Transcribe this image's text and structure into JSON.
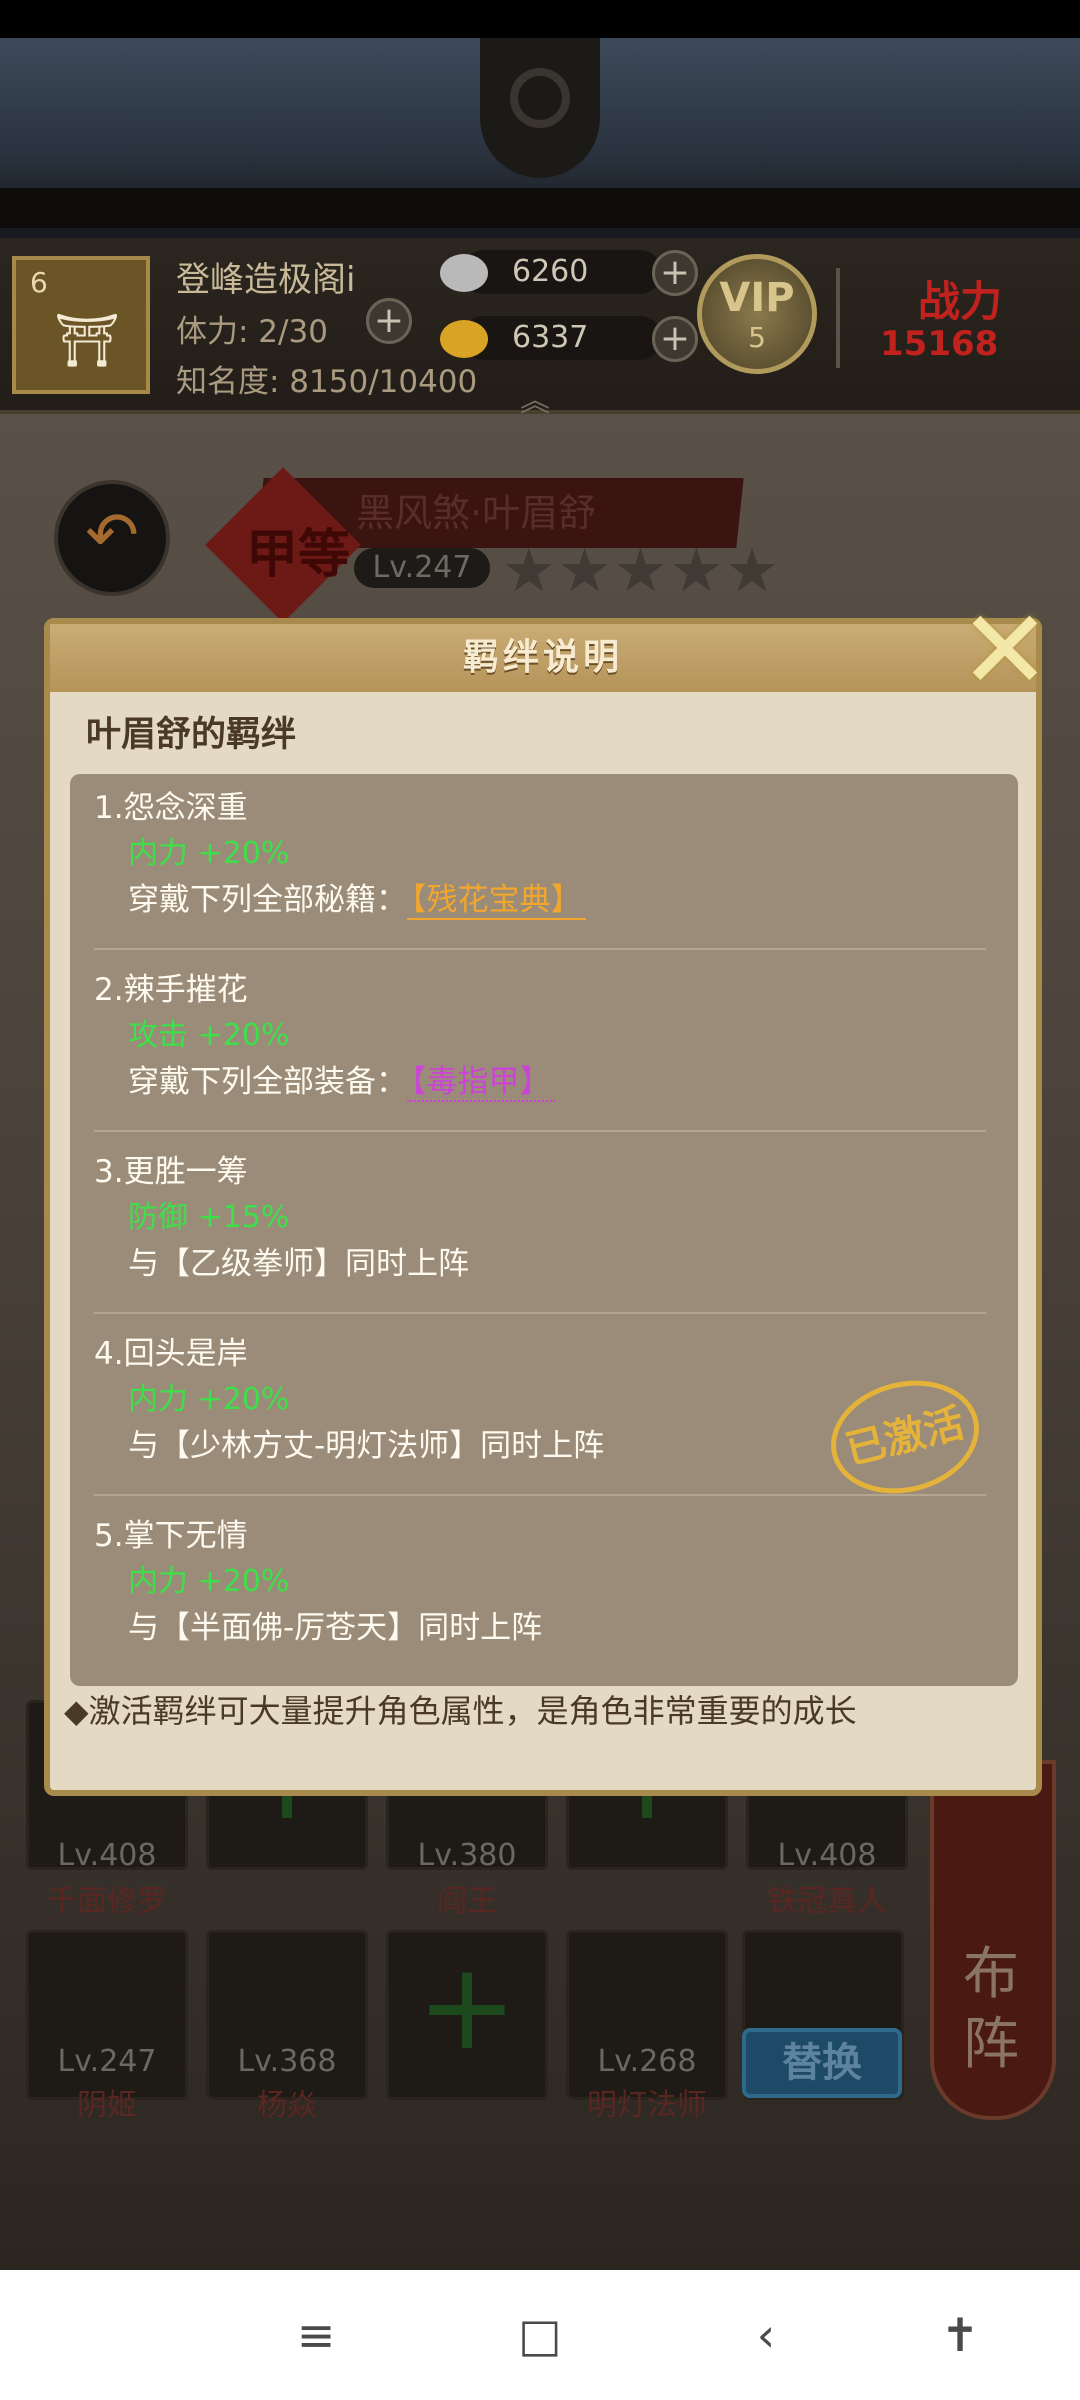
{
  "player": {
    "level": "6",
    "name": "登峰造极阁i",
    "stamina": "体力: 2/30",
    "fame": "知名度: 8150/10400",
    "silver": "6260",
    "gold": "6337",
    "vip_label": "VIP",
    "vip_level": "5",
    "power_label": "战力",
    "power_value": "15168"
  },
  "hero": {
    "title": "黑风煞·叶眉舒",
    "grade": "甲等",
    "level": "Lv.247",
    "stars": 5
  },
  "modal": {
    "title": "羁绊说明",
    "heading": "叶眉舒的羁绊",
    "bonds": [
      {
        "title": "1.怨念深重",
        "bonus": "内力 +20%",
        "condition": "穿戴下列全部秘籍：",
        "item": "【残花宝典】",
        "item_color": "#f2a62d"
      },
      {
        "title": "2.辣手摧花",
        "bonus": "攻击 +20%",
        "condition": "穿戴下列全部装备：",
        "item": "【毒指甲】",
        "item_color": "#cc44d6"
      },
      {
        "title": "3.更胜一筹",
        "bonus": "防御 +15%",
        "condition": "与【乙级拳师】同时上阵"
      },
      {
        "title": "4.回头是岸",
        "bonus": "内力 +20%",
        "condition": "与【少林方丈-明灯法师】同时上阵",
        "stamp": "已激活"
      },
      {
        "title": "5.掌下无情",
        "bonus": "内力 +20%",
        "condition": "与【半面佛-厉苍天】同时上阵"
      }
    ],
    "footnote": "◆激活羁绊可大量提升角色属性，是角色非常重要的成长"
  },
  "roster": {
    "row1": [
      {
        "level": "Lv.408",
        "name": "千面修罗"
      },
      {
        "level": "",
        "name": ""
      },
      {
        "level": "Lv.380",
        "name": "阎王"
      },
      {
        "level": "",
        "name": ""
      },
      {
        "level": "Lv.408",
        "name": "铁冠真人"
      }
    ],
    "row2": [
      {
        "level": "Lv.247",
        "name": "阴姬"
      },
      {
        "level": "Lv.368",
        "name": "杨焱"
      },
      {
        "level": "",
        "name": ""
      },
      {
        "level": "Lv.268",
        "name": "明灯法师"
      }
    ],
    "replace_label": "替换",
    "formation_label": "布阵"
  },
  "colors": {
    "bonus_green": "#3ee04a",
    "modal_bg": "#e4d9c2",
    "modal_border": "#a98a4d",
    "bond_panel": "#9a8c78",
    "stamp_gold": "#e5b23a"
  },
  "icons": {
    "close": "close-icon",
    "back": "back-arrow-icon",
    "silver": "silver-ingot-icon",
    "gold": "gold-ingot-icon"
  },
  "nav": {
    "menu": "≡",
    "home": "□",
    "back": "‹",
    "accessibility": "✝"
  }
}
